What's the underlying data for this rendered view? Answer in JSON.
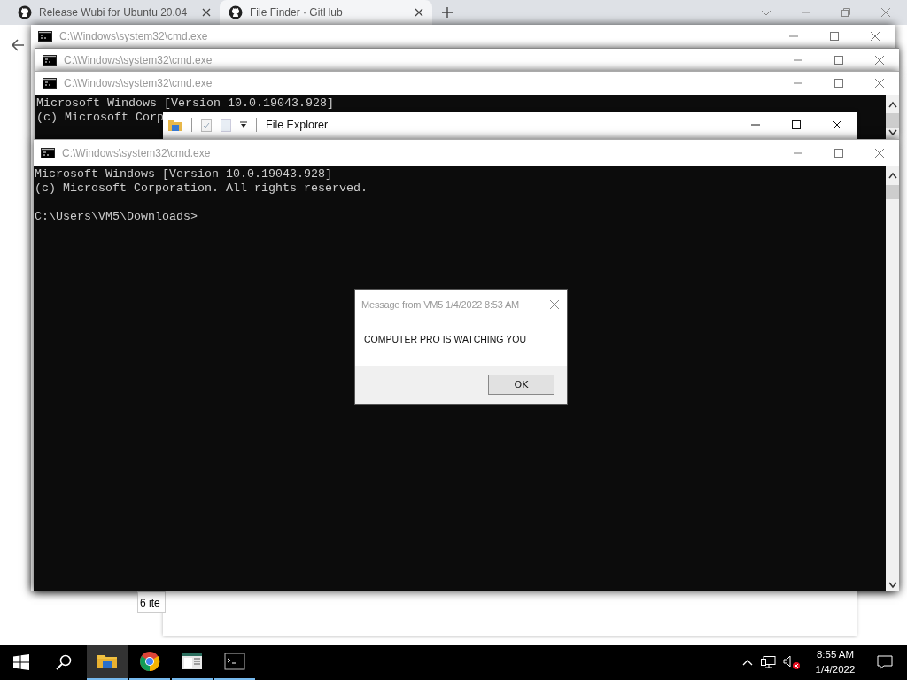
{
  "browser": {
    "tabs": [
      {
        "title": "Release Wubi for Ubuntu 20.04",
        "selected": false
      },
      {
        "title": "File Finder · GitHub",
        "selected": true
      }
    ]
  },
  "windows": [
    {
      "kind": "cmd",
      "title": "C:\\Windows\\system32\\cmd.exe"
    },
    {
      "kind": "cmd",
      "title": "C:\\Windows\\system32\\cmd.exe"
    },
    {
      "kind": "cmd",
      "title": "C:\\Windows\\system32\\cmd.exe",
      "lines": [
        "Microsoft Windows [Version 10.0.19043.928]",
        "(c) Microsoft Corp"
      ]
    },
    {
      "kind": "explorer",
      "title": "File Explorer",
      "status": "6 ite"
    },
    {
      "kind": "cmd",
      "title": "C:\\Windows\\system32\\cmd.exe",
      "lines": [
        "Microsoft Windows [Version 10.0.19043.928]",
        "(c) Microsoft Corporation. All rights reserved."
      ],
      "prompt": "C:\\Users\\VM5\\Downloads>"
    }
  ],
  "dialog": {
    "title": "Message from VM5 1/4/2022 8:53 AM",
    "message": "COMPUTER PRO IS WATCHING YOU",
    "button": "OK"
  },
  "taskbar": {
    "apps": [
      {
        "kind": "explorer",
        "selected": true
      },
      {
        "kind": "chrome",
        "selected": false
      },
      {
        "kind": "editor",
        "selected": false
      },
      {
        "kind": "cmd",
        "selected": false
      }
    ],
    "time": "8:55 AM",
    "date": "1/4/2022"
  }
}
